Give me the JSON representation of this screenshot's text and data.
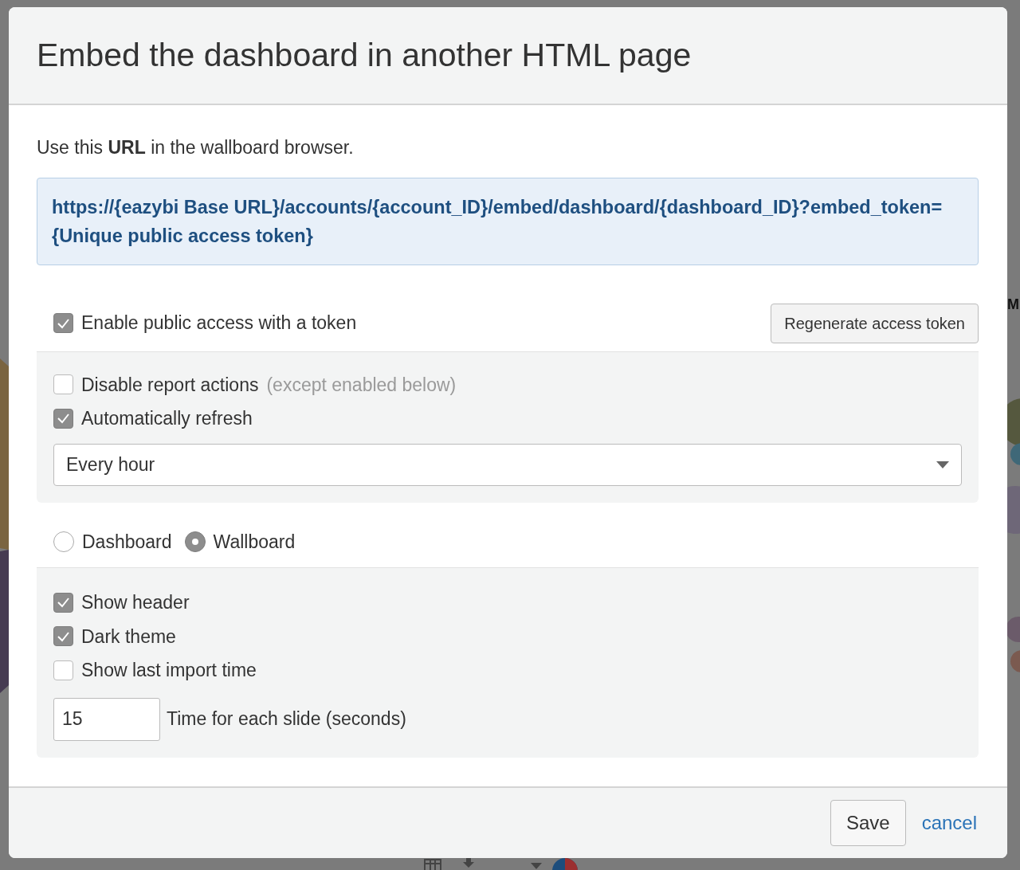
{
  "background": {
    "column_label": "M"
  },
  "dialog": {
    "title": "Embed the dashboard in another HTML page",
    "intro": "Use this **URL** in the wallboard browser.",
    "url": "https://{eazybi Base URL}/accounts/{account_ID}/embed/dashboard/{dashboard_ID}?embed_token={Unique public access token}",
    "public_access": {
      "label": "Enable public access with a token",
      "checked": true
    },
    "regenerate_button": "Regenerate access token",
    "report_options": [
      {
        "label": "Disable report actions",
        "note": "(except enabled below)",
        "checked": false
      },
      {
        "label": "Automatically refresh",
        "checked": true
      }
    ],
    "refresh_interval": {
      "value": "Every hour"
    },
    "modes": [
      {
        "label": "Dashboard",
        "selected": false
      },
      {
        "label": "Wallboard",
        "selected": true
      }
    ],
    "wallboard_options": [
      {
        "label": "Show header",
        "checked": true
      },
      {
        "label": "Dark theme",
        "checked": true
      },
      {
        "label": "Show last import time",
        "checked": false
      }
    ],
    "slide_time": {
      "value": "15",
      "label": "Time for each slide (seconds)"
    },
    "buttons": {
      "save": "Save",
      "cancel": "cancel"
    }
  }
}
